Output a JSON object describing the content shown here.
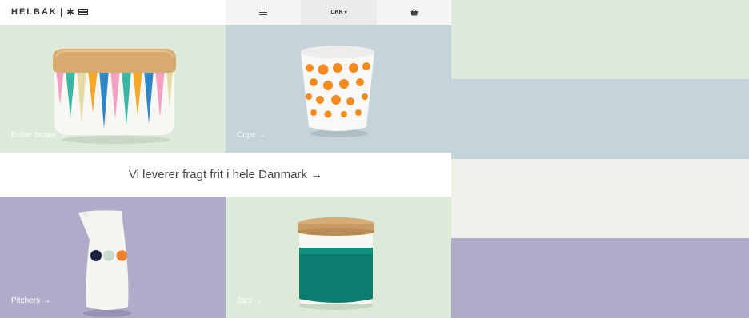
{
  "header": {
    "logo_text": "HELBAK",
    "currency": "DKK"
  },
  "tiles": [
    {
      "label": "Butter boxes",
      "arrow": "→",
      "bg": "#dde9d9"
    },
    {
      "label": "Cups",
      "arrow": "→",
      "bg": "#c4d4da"
    },
    {
      "label": "Pitchers",
      "arrow": "→",
      "bg": "#b0abc8"
    },
    {
      "label": "Jars",
      "arrow": "→",
      "bg": "#dde9d9"
    }
  ],
  "banner": {
    "text": "Vi leverer fragt frit i hele Danmark →"
  },
  "colors": {
    "swatch_mint": "#dde9d9",
    "swatch_blue": "#c4d4da",
    "swatch_cream": "#f2f0ea",
    "swatch_lavender": "#b0abc8"
  },
  "icons": [
    "star-icon",
    "flag-icon",
    "menu-icon",
    "basket-icon"
  ]
}
